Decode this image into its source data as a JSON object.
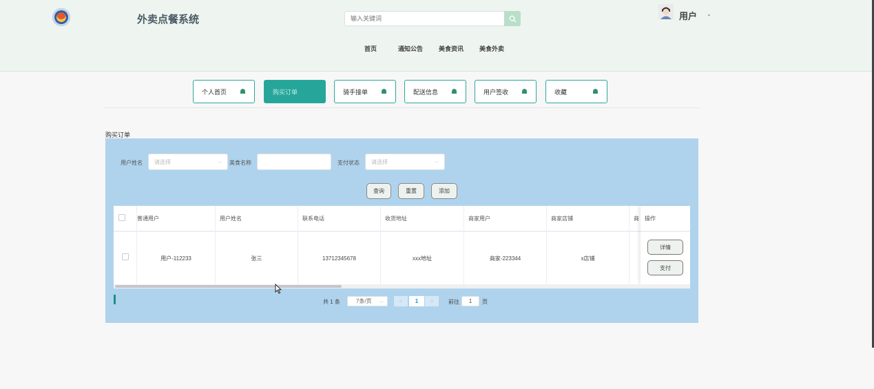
{
  "header": {
    "app_title": "外卖点餐系统",
    "search_placeholder": "输入关键词",
    "nav": [
      "首页",
      "通知公告",
      "美食资讯",
      "美食外卖"
    ],
    "user_label": "用户",
    "user_caret": "⌄"
  },
  "tabs": [
    {
      "label": "个人首页",
      "active": false
    },
    {
      "label": "购买订单",
      "active": true
    },
    {
      "label": "骑手接单",
      "active": false
    },
    {
      "label": "配送信息",
      "active": false
    },
    {
      "label": "用户签收",
      "active": false
    },
    {
      "label": "收藏",
      "active": false
    }
  ],
  "section_title": "购买订单",
  "filters": {
    "user_name_label": "用户姓名",
    "user_name_placeholder": "请选择",
    "food_name_label": "美食名称",
    "pay_status_label": "支付状态",
    "pay_status_placeholder": "请选择"
  },
  "actions": {
    "query": "查询",
    "reset": "重置",
    "add": "添加"
  },
  "table": {
    "columns": [
      "普通用户",
      "用户姓名",
      "联系电话",
      "收货地址",
      "商家用户",
      "商家店铺",
      "商",
      "操作"
    ],
    "rows": [
      {
        "cells": [
          "用户-112233",
          "张三",
          "13712345678",
          "xxx地址",
          "商家-223344",
          "x店铺"
        ],
        "ops": [
          "详情",
          "支付"
        ]
      }
    ]
  },
  "pagination": {
    "total_text": "共 1 条",
    "page_size": "7条/页",
    "current_page": "1",
    "goto_label": "前往",
    "goto_value": "1",
    "page_suffix": "页"
  },
  "colors": {
    "accent": "#26a69a",
    "panel": "#afd3ed",
    "header_bg": "#eef4ef"
  }
}
